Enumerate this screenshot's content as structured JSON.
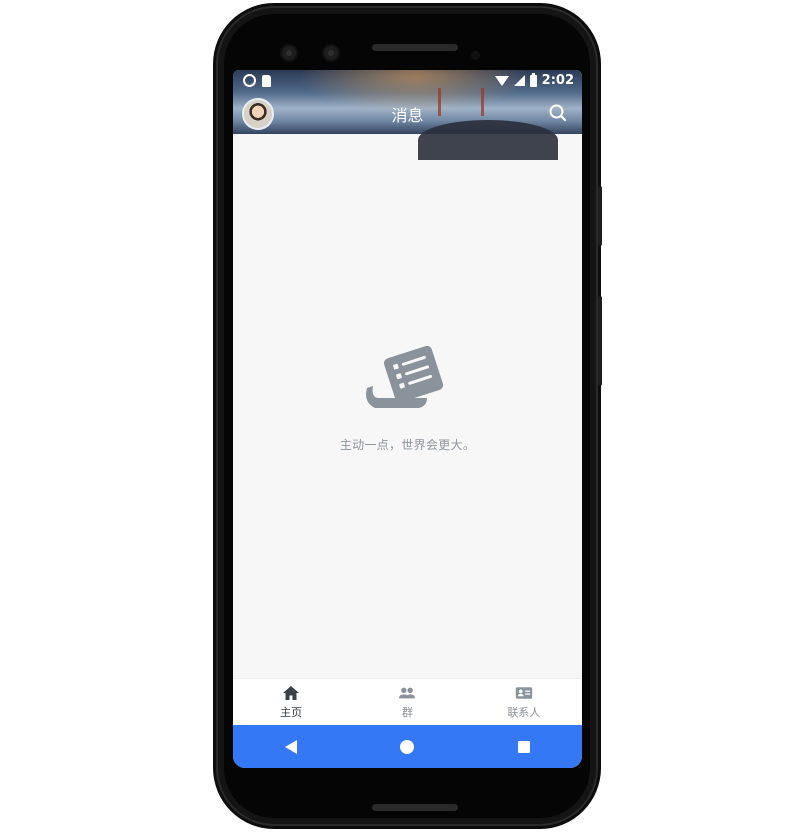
{
  "status_bar": {
    "time": "2:02"
  },
  "header": {
    "title": "消息"
  },
  "empty_state": {
    "message": "主动一点，世界会更大。"
  },
  "bottom_nav": {
    "items": [
      {
        "label": "主页",
        "icon": "home-icon",
        "active": true
      },
      {
        "label": "群",
        "icon": "group-icon",
        "active": false
      },
      {
        "label": "联系人",
        "icon": "contact-card-icon",
        "active": false
      }
    ]
  },
  "colors": {
    "accent_nav": "#3478f6",
    "empty_icon": "#8a939c",
    "screen_bg": "#f7f7f7"
  }
}
